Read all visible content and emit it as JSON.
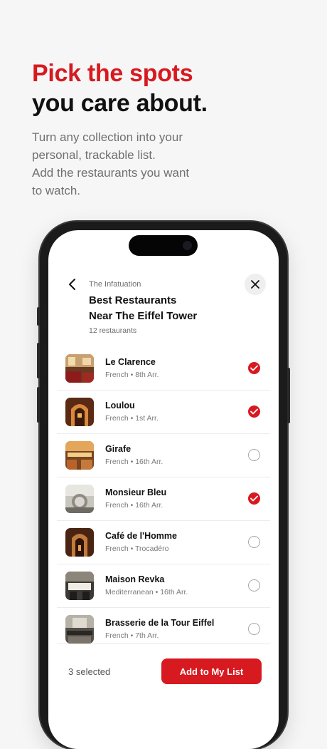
{
  "hero": {
    "line1": "Pick the spots",
    "line2": "you care about.",
    "subtitle": [
      "Turn any collection into your",
      "personal, trackable list.",
      "Add the restaurants you want",
      "to watch."
    ]
  },
  "colors": {
    "accent": "#d71920",
    "text": "#111111",
    "muted": "#707070"
  },
  "header": {
    "source": "The Infatuation",
    "title_line1": "Best Restaurants",
    "title_line2": "Near The Eiffel Tower",
    "count": "12 restaurants",
    "back_icon": "chevron-left-icon",
    "close_icon": "close-icon"
  },
  "restaurants": [
    {
      "name": "Le Clarence",
      "meta": "French • 8th Arr.",
      "selected": true
    },
    {
      "name": "Loulou",
      "meta": "French • 1st Arr.",
      "selected": true
    },
    {
      "name": "Girafe",
      "meta": "French • 16th Arr.",
      "selected": false
    },
    {
      "name": "Monsieur Bleu",
      "meta": "French • 16th Arr.",
      "selected": true
    },
    {
      "name": "Café de l'Homme",
      "meta": "French • Trocadéro",
      "selected": false
    },
    {
      "name": "Maison Revka",
      "meta": "Mediterranean • 16th Arr.",
      "selected": false
    },
    {
      "name": "Brasserie de la Tour Eiffel",
      "meta": "French • 7th Arr.",
      "selected": false
    }
  ],
  "footer": {
    "selected_text": "3 selected",
    "button_label": "Add to My List"
  }
}
